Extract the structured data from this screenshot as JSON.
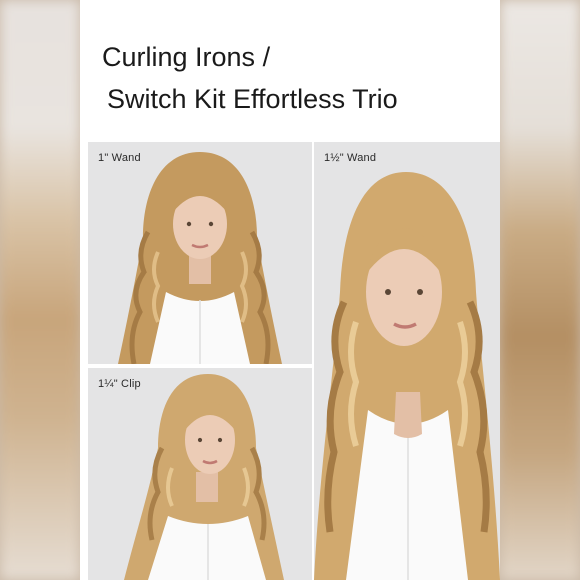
{
  "title": {
    "line1": "Curling Irons /",
    "line2": "Switch Kit Effortless Trio"
  },
  "panels": [
    {
      "label": "1\" Wand"
    },
    {
      "label": "1¼\" Clip"
    },
    {
      "label": "1½\" Wand"
    }
  ],
  "colors": {
    "panel_bg": "#e4e4e5",
    "hair": "#c9a46c",
    "shirt": "#fafafa",
    "skin": "#e9c9b3"
  }
}
